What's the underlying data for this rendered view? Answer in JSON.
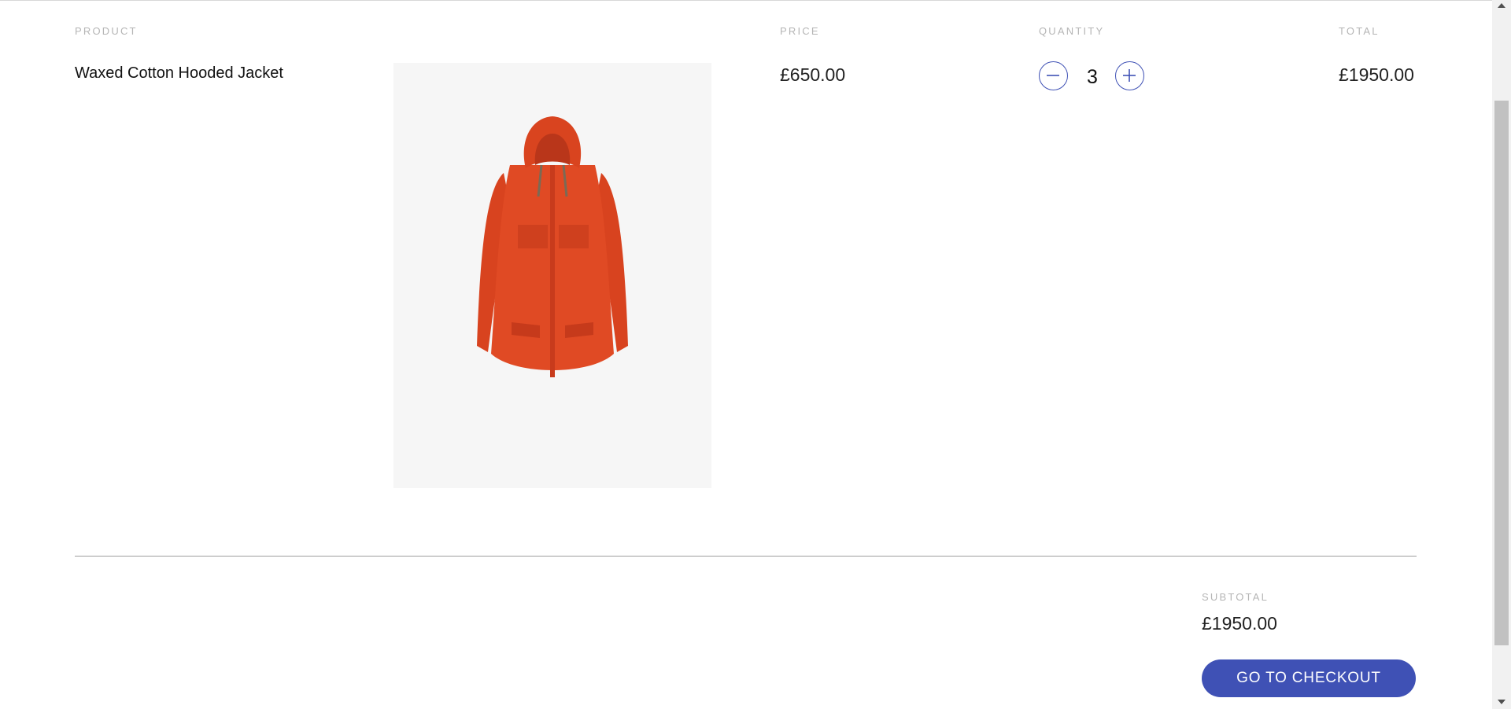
{
  "cart": {
    "headers": {
      "product": "PRODUCT",
      "price": "PRICE",
      "quantity": "QUANTITY",
      "total": "TOTAL"
    },
    "items": [
      {
        "name": "Waxed Cotton Hooded Jacket",
        "image_icon": "orange-hooded-jacket",
        "price": "£650.00",
        "quantity": "3",
        "total": "£1950.00"
      }
    ],
    "subtotal_label": "SUBTOTAL",
    "subtotal": "£1950.00",
    "checkout_label": "GO TO CHECKOUT"
  },
  "colors": {
    "accent": "#3f51b5",
    "product": "#e04a24",
    "image_bg": "#f6f6f6"
  },
  "icons": {
    "decrease": "minus-icon",
    "increase": "plus-icon",
    "scroll_up": "arrow-up-icon",
    "scroll_down": "arrow-down-icon"
  }
}
